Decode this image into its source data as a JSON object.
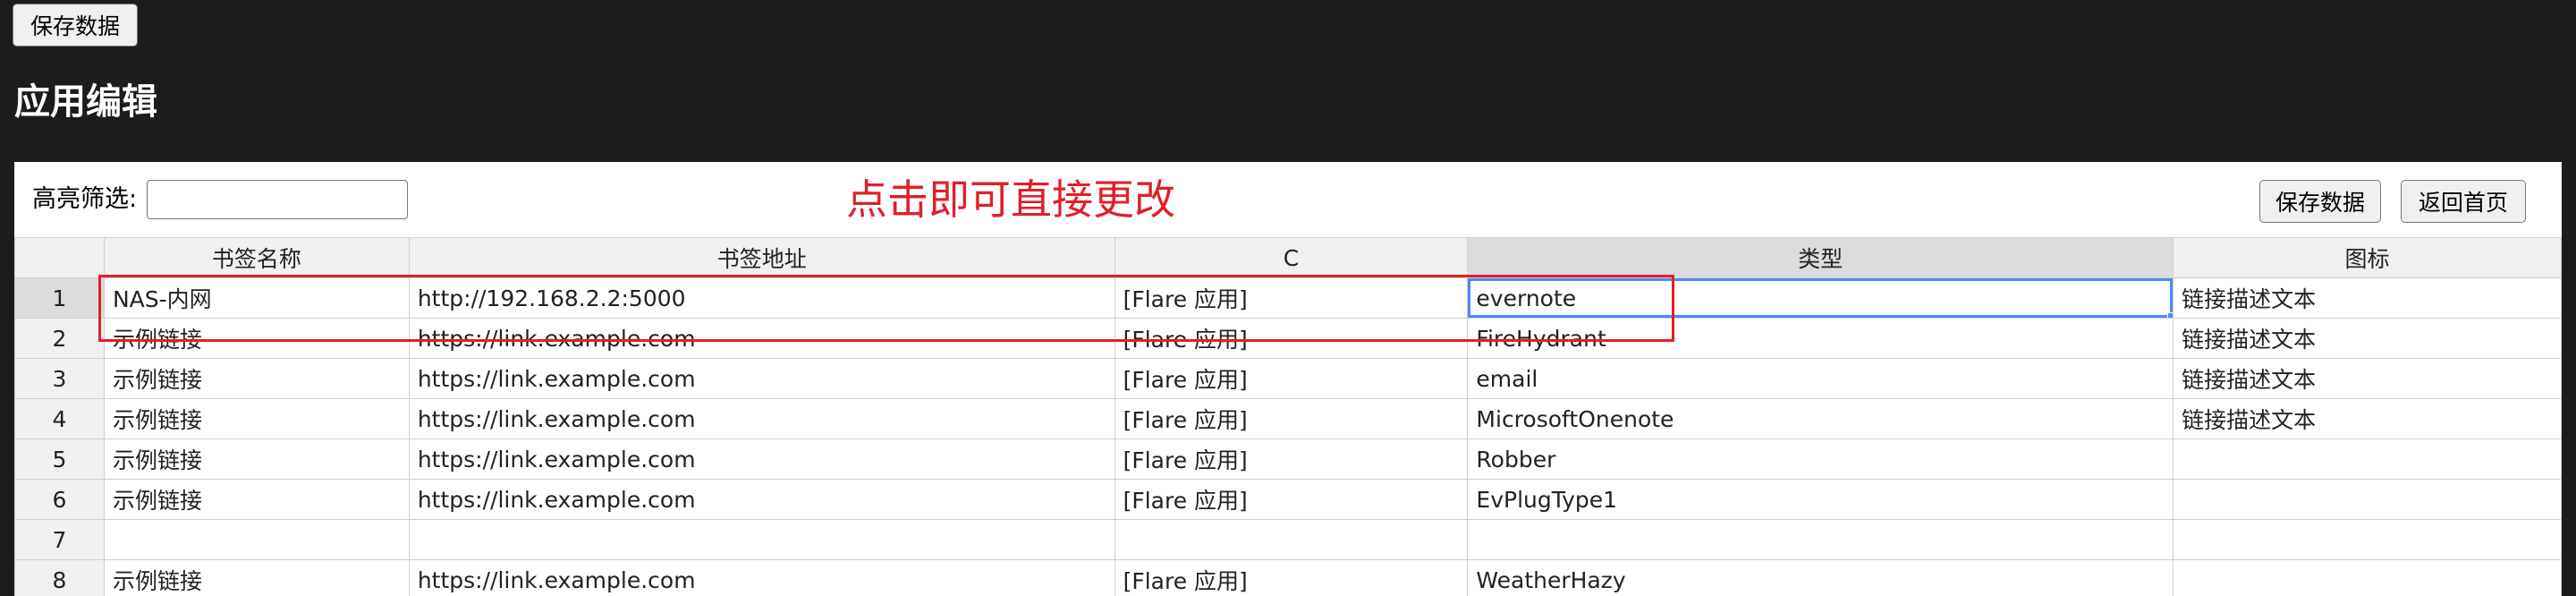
{
  "toolbar": {
    "save_label": "保存数据"
  },
  "title": "应用编辑",
  "filter": {
    "label": "高亮筛选:",
    "value": ""
  },
  "hint": "点击即可直接更改",
  "panel_buttons": {
    "save_label": "保存数据",
    "home_label": "返回首页"
  },
  "table": {
    "columns": [
      "书签名称",
      "书签地址",
      "C",
      "类型",
      "图标"
    ],
    "rows": [
      {
        "n": "1",
        "cells": [
          "NAS-内网",
          "http://192.168.2.2:5000",
          "[Flare 应用]",
          "evernote",
          "链接描述文本"
        ]
      },
      {
        "n": "2",
        "cells": [
          "示例链接",
          "https://link.example.com",
          "[Flare 应用]",
          "FireHydrant",
          "链接描述文本"
        ]
      },
      {
        "n": "3",
        "cells": [
          "示例链接",
          "https://link.example.com",
          "[Flare 应用]",
          "email",
          "链接描述文本"
        ]
      },
      {
        "n": "4",
        "cells": [
          "示例链接",
          "https://link.example.com",
          "[Flare 应用]",
          "MicrosoftOnenote",
          "链接描述文本"
        ]
      },
      {
        "n": "5",
        "cells": [
          "示例链接",
          "https://link.example.com",
          "[Flare 应用]",
          "Robber",
          ""
        ]
      },
      {
        "n": "6",
        "cells": [
          "示例链接",
          "https://link.example.com",
          "[Flare 应用]",
          "EvPlugType1",
          ""
        ]
      },
      {
        "n": "7",
        "cells": [
          "",
          "",
          "",
          "",
          ""
        ]
      },
      {
        "n": "8",
        "cells": [
          "示例链接",
          "https://link.example.com",
          "[Flare 应用]",
          "WeatherHazy",
          ""
        ]
      }
    ]
  },
  "colors": {
    "background": "#1c1c1c",
    "hint": "#e0202a",
    "active_cell": "#4b89ff"
  }
}
